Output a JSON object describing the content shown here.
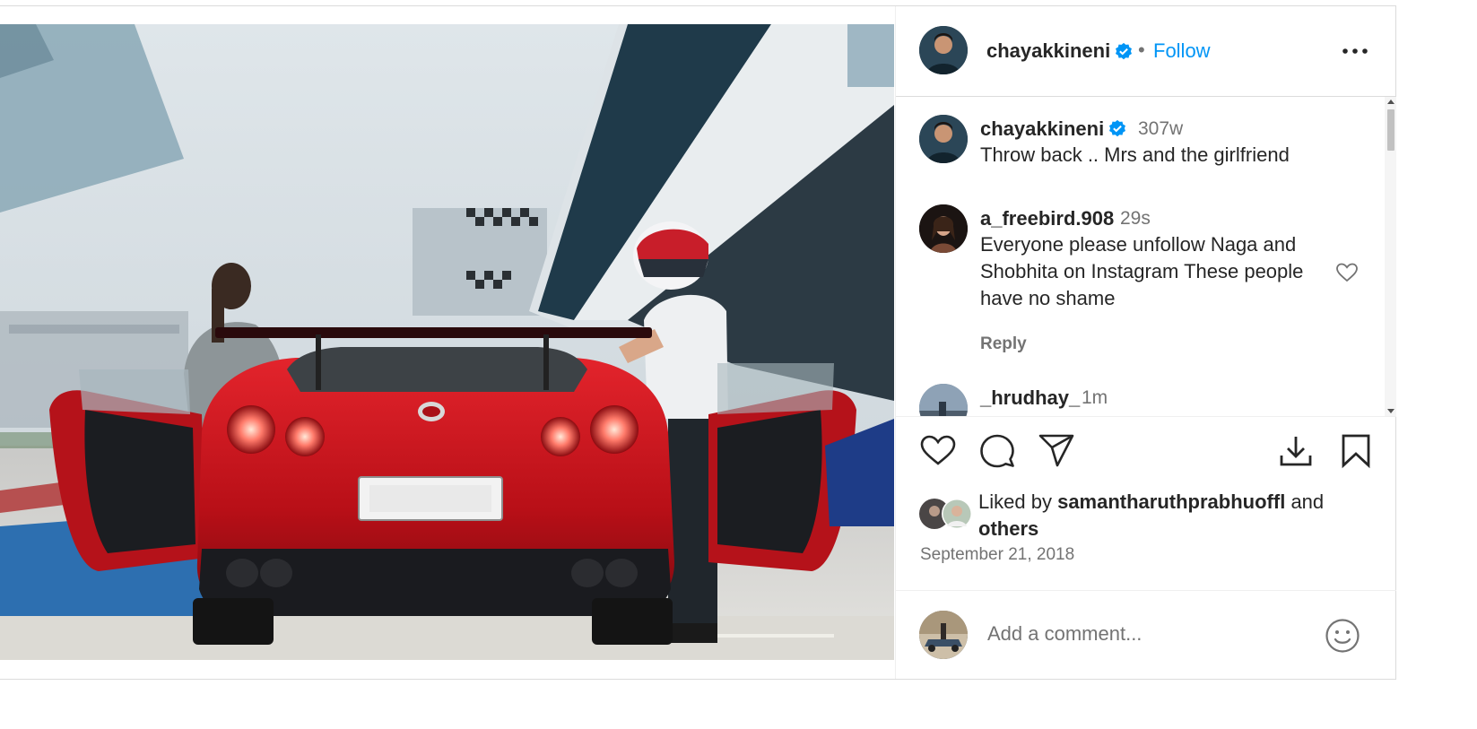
{
  "header": {
    "username": "chayakkineni",
    "separator": "•",
    "follow_label": "Follow"
  },
  "comments": [
    {
      "username": "chayakkineni",
      "time": "307w",
      "text": "Throw back .. Mrs and the girlfriend"
    },
    {
      "username": "a_freebird.908",
      "time": "29s",
      "text_lines": [
        "Everyone please unfollow Naga and",
        "Shobhita on Instagram These people",
        "have no shame"
      ],
      "reply_label": "Reply"
    },
    {
      "username": "_hrudhay_",
      "time": "1m"
    }
  ],
  "actions": {
    "icons": [
      "heart-icon",
      "comment-icon",
      "share-icon",
      "download-icon",
      "bookmark-icon"
    ]
  },
  "likes": {
    "prefix": "Liked by",
    "user": "samantharuthprabhuoffl",
    "conjunction": "and",
    "others": "others"
  },
  "date": "September 21, 2018",
  "add_comment": {
    "placeholder": "Add a comment..."
  },
  "colors": {
    "link": "#0095f6",
    "verified": "#0095f6",
    "muted": "#737373",
    "car_red": "#c8141c"
  }
}
